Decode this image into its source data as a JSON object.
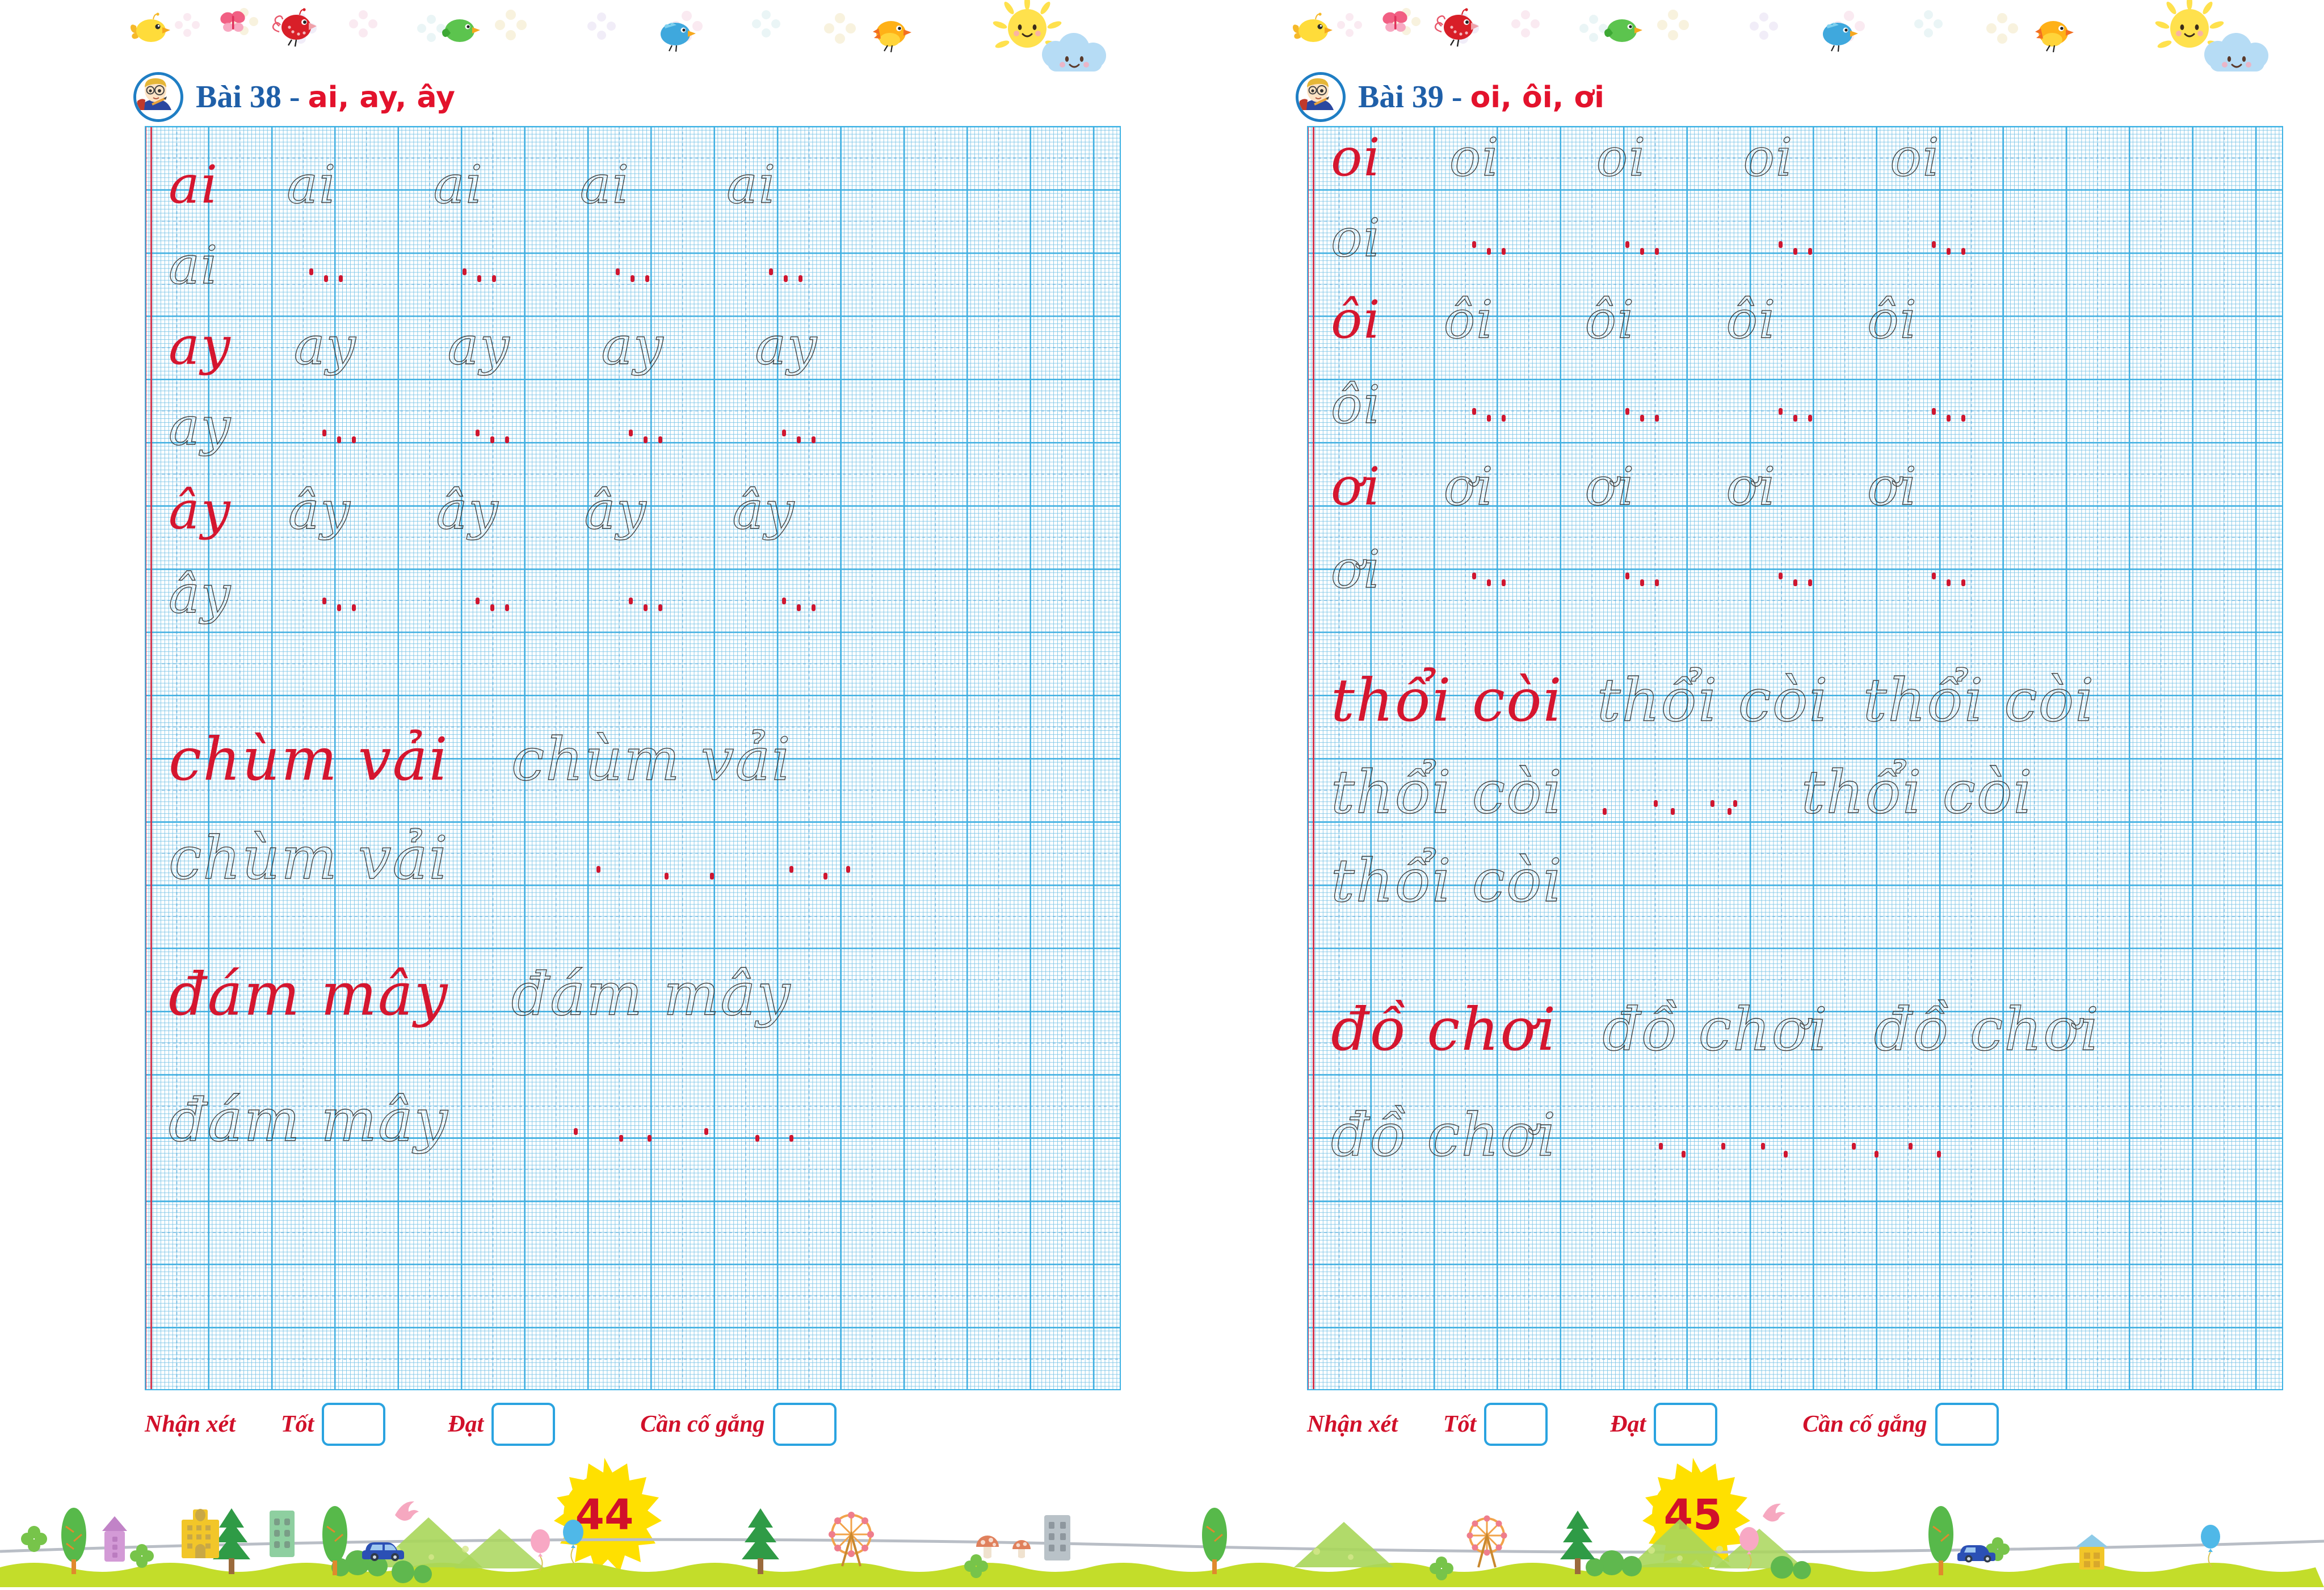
{
  "document": {
    "kind": "vietnamese-handwriting-workbook",
    "spread": "two-page",
    "colors": {
      "title_blue": "#1f5fa8",
      "title_red": "#e3122c",
      "model_red": "#d5162f",
      "grid_blue": "#3fb3e4",
      "grid_blue_light": "#78c3e6",
      "margin_red": "#d4374f",
      "box_blue": "#2aa3e0",
      "page_badge_yellow": "#ffe000",
      "page_num_red": "#d1102a",
      "grass_green": "#c3dd2a"
    }
  },
  "decor": {
    "top_border": {
      "name": "top-decorative-border",
      "items": [
        "bird-yellow",
        "butterfly-pink",
        "bird-red",
        "flower",
        "bird-green",
        "butterfly-blue",
        "flower",
        "bird-blue",
        "bird-orange",
        "sun-smiling",
        "cloud-smiling"
      ]
    },
    "bottom_border": {
      "name": "bottom-landscape-border",
      "items": [
        "clover",
        "tree",
        "house-purple",
        "building-yellow",
        "pine-tree",
        "building-green",
        "car-blue",
        "bird-pink",
        "tree",
        "hill-green",
        "hill-green",
        "clover",
        "balloon-pink",
        "balloon-blue",
        "ferris-wheel",
        "mushroom",
        "building-grey",
        "house-blue"
      ]
    }
  },
  "left_page": {
    "title": {
      "prefix": "Bài 38 - ",
      "letters": "ai, ay, ây",
      "avatar_icon": "boy-writing-icon"
    },
    "rows": [
      {
        "id": "ai-model",
        "type": "model-row",
        "text": "ai",
        "samples": 5,
        "first_red": true
      },
      {
        "id": "ai-trace",
        "type": "trace-row",
        "text": "ai",
        "samples": 1,
        "dot_groups": 4
      },
      {
        "id": "ay-model",
        "type": "model-row",
        "text": "ay",
        "samples": 5,
        "first_red": true
      },
      {
        "id": "ay-trace",
        "type": "trace-row",
        "text": "ay",
        "samples": 1,
        "dot_groups": 4
      },
      {
        "id": "ay2-model",
        "type": "model-row",
        "text": "ây",
        "samples": 5,
        "first_red": true
      },
      {
        "id": "ay2-trace",
        "type": "trace-row",
        "text": "ây",
        "samples": 1,
        "dot_groups": 4
      },
      {
        "id": "word1-model",
        "type": "model-word",
        "text": "chùm vải",
        "samples": 2,
        "first_red": true
      },
      {
        "id": "word1-trace",
        "type": "trace-word",
        "text": "chùm vải",
        "samples": 1,
        "dot_groups": 3
      },
      {
        "id": "word2-model",
        "type": "model-word",
        "text": "đám mây",
        "samples": 2,
        "first_red": true
      },
      {
        "id": "word2-trace",
        "type": "trace-word",
        "text": "đám mây",
        "samples": 1,
        "dot_groups": 3
      }
    ],
    "footer": {
      "label": "Nhận xét",
      "options": [
        {
          "label": "Tốt",
          "checkbox": ""
        },
        {
          "label": "Đạt",
          "checkbox": ""
        },
        {
          "label": "Cần cố gắng",
          "checkbox": ""
        }
      ]
    },
    "page_number": "44"
  },
  "right_page": {
    "title": {
      "prefix": "Bài 39 - ",
      "letters": "oi, ôi, ơi",
      "avatar_icon": "boy-writing-icon"
    },
    "rows": [
      {
        "id": "oi-model",
        "type": "model-row",
        "text": "oi",
        "samples": 5,
        "first_red": true
      },
      {
        "id": "oi-trace",
        "type": "trace-row",
        "text": "oi",
        "samples": 1,
        "dot_groups": 4
      },
      {
        "id": "oi2-model",
        "type": "model-row",
        "text": "ôi",
        "samples": 5,
        "first_red": true
      },
      {
        "id": "oi2-trace",
        "type": "trace-row",
        "text": "ôi",
        "samples": 1,
        "dot_groups": 4
      },
      {
        "id": "oi3-model",
        "type": "model-row",
        "text": "ơi",
        "samples": 5,
        "first_red": true
      },
      {
        "id": "oi3-trace",
        "type": "trace-row",
        "text": "ơi",
        "samples": 1,
        "dot_groups": 4
      },
      {
        "id": "word1-model",
        "type": "model-word",
        "text": "thổi còi",
        "samples": 3,
        "first_red": true
      },
      {
        "id": "word1-mid",
        "type": "trace-word",
        "text": "thổi còi",
        "samples": 2,
        "dot_groups": 2
      },
      {
        "id": "word1-trace",
        "type": "trace-word",
        "text": "thổi còi",
        "samples": 1,
        "dot_groups": 0
      },
      {
        "id": "word2-model",
        "type": "model-word",
        "text": "đồ chơi",
        "samples": 3,
        "first_red": true
      },
      {
        "id": "word2-trace",
        "type": "trace-word",
        "text": "đồ chơi",
        "samples": 1,
        "dot_groups": 3
      }
    ],
    "footer": {
      "label": "Nhận xét",
      "options": [
        {
          "label": "Tốt",
          "checkbox": ""
        },
        {
          "label": "Đạt",
          "checkbox": ""
        },
        {
          "label": "Cần cố gắng",
          "checkbox": ""
        }
      ]
    },
    "page_number": "45"
  }
}
